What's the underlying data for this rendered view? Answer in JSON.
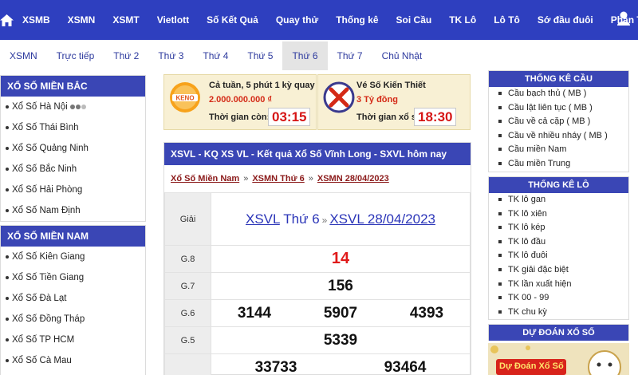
{
  "nav": {
    "home_icon": "home-icon",
    "user_icon": "user-icon",
    "items": [
      "XSMB",
      "XSMN",
      "XSMT",
      "Vietlott",
      "Số Kết Quả",
      "Quay thử",
      "Thống kê",
      "Soi Cầu",
      "TK Lô",
      "Lô Tô",
      "Sớ đầu đuôi",
      "Phân Tích"
    ]
  },
  "subnav": {
    "items": [
      "XSMN",
      "Trực tiếp",
      "Thứ 2",
      "Thứ 3",
      "Thứ 4",
      "Thứ 5",
      "Thứ 6",
      "Thứ 7",
      "Chủ Nhật"
    ],
    "active": "Thứ 6"
  },
  "left": {
    "mienbac": {
      "title": "XỔ SỐ MIỀN BẮC",
      "items": [
        "Xổ Số Hà Nội",
        "Xổ Số Thái Bình",
        "Xổ Số Quảng Ninh",
        "Xổ Số Bắc Ninh",
        "Xổ Số Hải Phòng",
        "Xổ Số Nam Định"
      ]
    },
    "miennam": {
      "title": "XỔ SỐ MIỀN NAM",
      "items": [
        "Xổ Số Kiên Giang",
        "Xổ Số Tiền Giang",
        "Xổ Số Đà Lạt",
        "Xổ Số Đồng Tháp",
        "Xổ Số TP HCM",
        "Xổ Số Cà Mau"
      ]
    }
  },
  "promo1": {
    "logo": "keno-logo",
    "title": "Cả tuần, 5 phút 1 kỳ quay",
    "prize": "2.000.000.000 ₫",
    "time_label": "Thời gian còn:",
    "time": "03:15"
  },
  "promo2": {
    "logo": "xskt-logo",
    "title": "Vé Số Kiến Thiết",
    "prize": "3 Tỷ đồng",
    "time_label": "Thời gian xổ số:",
    "time": "18:30"
  },
  "panel": {
    "title": "XSVL - KQ XS VL - Kết quả Xổ Số Vĩnh Long - SXVL hôm nay",
    "crumbs": [
      "Xổ Số Miền Nam",
      "XSMN Thứ 6",
      "XSMN 28/04/2023"
    ],
    "crumb_sep": "»",
    "giai_label": "Giải",
    "result_link1": "XSVL",
    "result_mid": "Thứ 6",
    "result_arrow": "»",
    "result_link2": "XSVL 28/04/2023",
    "rows": [
      {
        "label": "G.8",
        "values": [
          "14"
        ]
      },
      {
        "label": "G.7",
        "values": [
          "156"
        ]
      },
      {
        "label": "G.6",
        "values": [
          "3144",
          "5907",
          "4393"
        ]
      },
      {
        "label": "G.5",
        "values": [
          "5339"
        ]
      },
      {
        "label": "",
        "values": [
          "33733",
          "93464"
        ]
      }
    ]
  },
  "right": {
    "cau": {
      "title": "THỐNG KÊ CẦU",
      "items": [
        "Cầu bạch thủ ( MB )",
        "Cầu lật liên tục ( MB )",
        "Cầu về cả cặp ( MB )",
        "Cầu về nhiều nháy ( MB )",
        "Cầu miền Nam",
        "Cầu miền Trung"
      ]
    },
    "lo": {
      "title": "THỐNG KÊ LÔ",
      "items": [
        "TK lô gan",
        "TK lô xiên",
        "TK lô kép",
        "TK lô đầu",
        "TK lô đuôi",
        "TK giải đặc biệt",
        "TK lần xuất hiện",
        "TK 00 - 99",
        "TK chu kỳ"
      ]
    },
    "dudoan": {
      "title": "DỰ ĐOÁN XỔ SỐ",
      "banner_text": "Dự Đoán Xổ Số"
    }
  },
  "colors": {
    "nav_bg": "#2e3fbf",
    "header_bg": "#3a46b5",
    "promo_bg": "#f8f0d4",
    "accent_red": "#d61515",
    "link_blue": "#2b35b8",
    "crumb_red": "#8b1a1a"
  }
}
